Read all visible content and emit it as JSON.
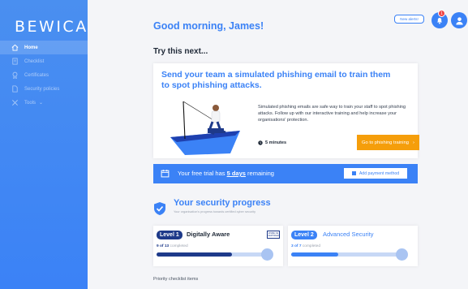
{
  "sidebar": {
    "logo": "BEWICA",
    "items": [
      {
        "label": "Home",
        "icon": "home-icon",
        "active": true
      },
      {
        "label": "Checklist",
        "icon": "checklist-icon",
        "active": false
      },
      {
        "label": "Certificates",
        "icon": "certificate-icon",
        "active": false
      },
      {
        "label": "Security policies",
        "icon": "document-icon",
        "active": false
      },
      {
        "label": "Tools",
        "icon": "tools-icon",
        "active": false
      }
    ]
  },
  "header": {
    "greeting": "Good morning, James!",
    "new_alerts": "New alerts!",
    "notification_count": "1"
  },
  "try_next": {
    "heading": "Try this next...",
    "card": {
      "title": "Send your team a simulated phishing email to train them to spot phishing attacks.",
      "description": "Simulated phishing emails are safe way to train your staff to spot phishing attacks. Follow up with our interactive training and help increase your organisations' protection.",
      "duration": "5 minutes",
      "button": "Go to phishing training"
    }
  },
  "trial": {
    "text_before": "Your free trial has ",
    "days": "5 days",
    "text_after": " remaining",
    "button": "Add payment method"
  },
  "security": {
    "title": "Your security progress",
    "subtitle": "Your organisation's progress towards certified cyber security",
    "levels": [
      {
        "badge": "Level 1",
        "name": "Digitally Aware",
        "done": "9 of 13",
        "suffix": "completed",
        "progress": 0.69,
        "cert": "IASME CE CERTIFIED"
      },
      {
        "badge": "Level 2",
        "name": "Advanced Security",
        "done": "3 of 7",
        "suffix": "completed",
        "progress": 0.43
      }
    ]
  },
  "priority": {
    "heading": "Priority checklist items"
  },
  "colors": {
    "primary": "#3b82f6",
    "dark": "#1e3a8a",
    "accent": "#f59e0b"
  }
}
